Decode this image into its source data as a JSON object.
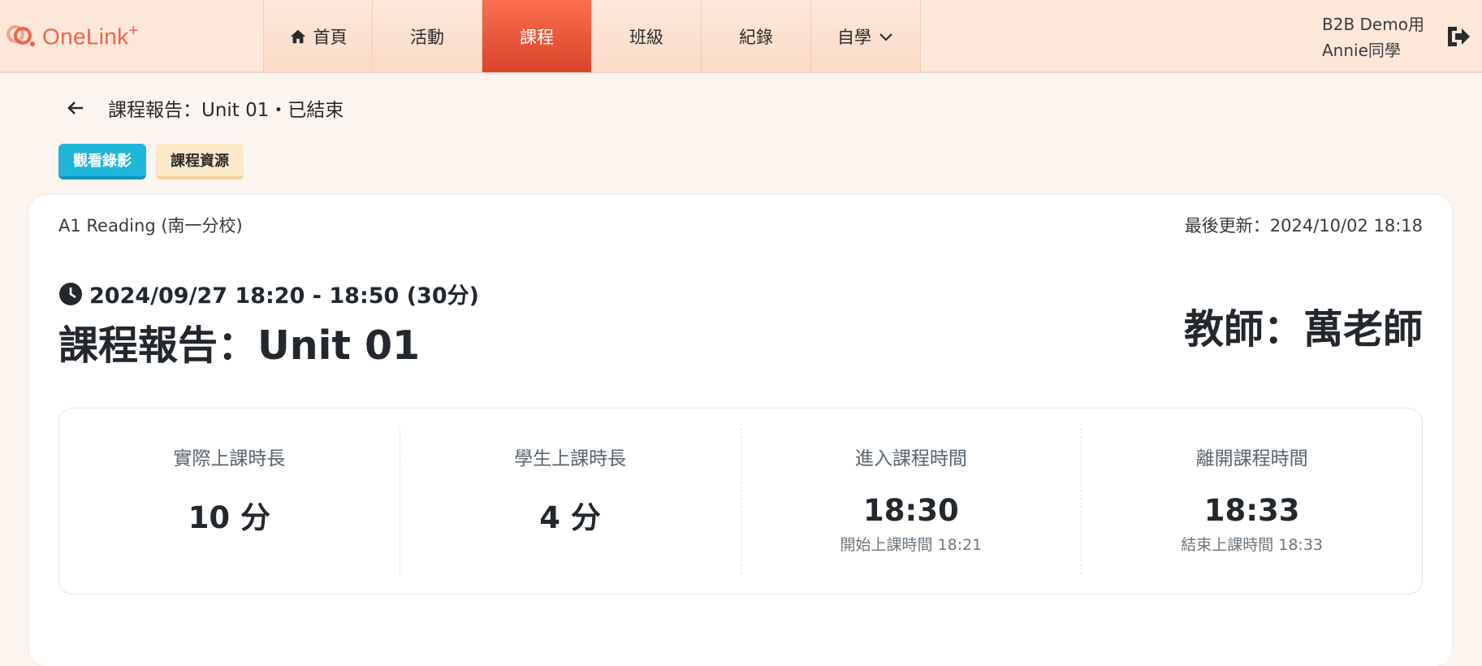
{
  "brand": {
    "name": "OneLink",
    "suffix": "+",
    "color": "#f0624c"
  },
  "nav": {
    "items": [
      {
        "label": "首頁",
        "icon": "home-icon"
      },
      {
        "label": "活動"
      },
      {
        "label": "課程",
        "active": true
      },
      {
        "label": "班級"
      },
      {
        "label": "紀錄"
      },
      {
        "label": "自學",
        "icon": "chevron-down-icon"
      }
    ],
    "active_color": "#e5523a"
  },
  "user": {
    "line1": "B2B Demo用",
    "line2": "Annie同學"
  },
  "breadcrumb": {
    "text": "課程報告：Unit 01・已結束"
  },
  "buttons": {
    "video": "觀看錄影",
    "resources": "課程資源"
  },
  "card": {
    "course": "A1 Reading (南一分校)",
    "updated": "最後更新：2024/10/02 18:18",
    "time": "2024/09/27 18:20 - 18:50 (30分)",
    "title": "課程報告：Unit 01",
    "teacher": "教師：萬老師"
  },
  "stats": [
    {
      "label": "實際上課時長",
      "value": "10 分",
      "sub": ""
    },
    {
      "label": "學生上課時長",
      "value": "4 分",
      "sub": ""
    },
    {
      "label": "進入課程時間",
      "value": "18:30",
      "sub": "開始上課時間 18:21"
    },
    {
      "label": "離開課程時間",
      "value": "18:33",
      "sub": "結束上課時間 18:33"
    }
  ]
}
